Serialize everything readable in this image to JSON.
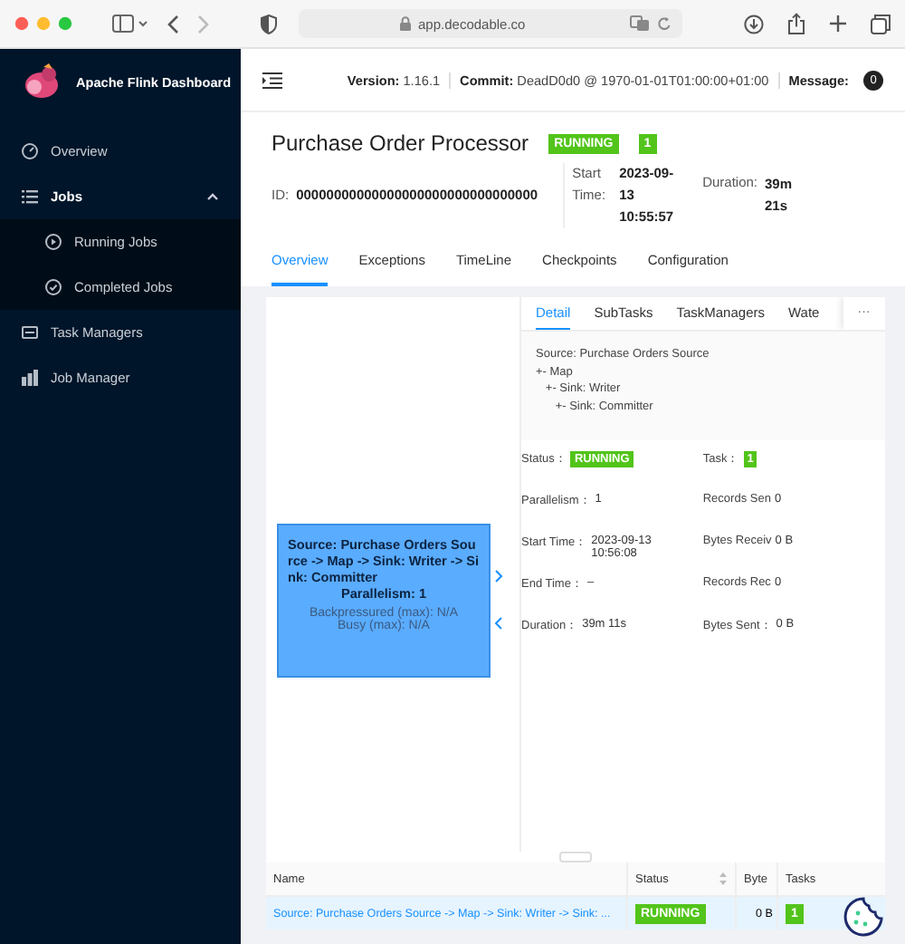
{
  "browser": {
    "url": "app.decodable.co"
  },
  "sidebar": {
    "title": "Apache Flink Dashboard",
    "items": [
      {
        "label": "Overview"
      },
      {
        "label": "Jobs",
        "expanded": true,
        "children": [
          {
            "label": "Running Jobs"
          },
          {
            "label": "Completed Jobs"
          }
        ]
      },
      {
        "label": "Task Managers"
      },
      {
        "label": "Job Manager"
      }
    ]
  },
  "header": {
    "version_label": "Version:",
    "version": "1.16.1",
    "commit_label": "Commit:",
    "commit": "DeadD0d0 @ 1970-01-01T01:00:00+01:00",
    "message_label": "Message:",
    "message_count": "0"
  },
  "job": {
    "title": "Purchase Order Processor",
    "status": "RUNNING",
    "tasks": "1",
    "fields": [
      {
        "label": "ID:",
        "value": "00000000000000000000000000000000"
      },
      {
        "label": "Start Time:",
        "value": "2023-09-13 10:55:57"
      },
      {
        "label": "Duration:",
        "value": "39m 21s"
      }
    ]
  },
  "tabs": [
    {
      "label": "Overview",
      "selected": true
    },
    {
      "label": "Exceptions",
      "selected": false
    },
    {
      "label": "TimeLine",
      "selected": false
    },
    {
      "label": "Checkpoints",
      "selected": false
    },
    {
      "label": "Configuration",
      "selected": false
    }
  ],
  "node": {
    "title": "Source: Purchase Orders Source -> Map -> Sink: Writer -> Sink: Committer",
    "parallelism": "Parallelism: 1",
    "metrics": [
      "Backpressured (max): N/A",
      "Busy (max): N/A"
    ]
  },
  "drawer": {
    "tabs": [
      {
        "label": "Detail",
        "selected": true
      },
      {
        "label": "SubTasks",
        "selected": false
      },
      {
        "label": "TaskManagers",
        "selected": false
      },
      {
        "label": "Wate",
        "selected": false
      }
    ],
    "more": "···",
    "plan": [
      "Source: Purchase Orders Source",
      "+- Map",
      "   +- Sink: Writer",
      "      +- Sink: Committer"
    ],
    "details": [
      {
        "label": "Status：",
        "value": "RUNNING",
        "kind": "tag"
      },
      {
        "label": "Task：",
        "value": "1",
        "kind": "tag"
      },
      {
        "label": "Parallelism：",
        "value": "1",
        "kind": "text"
      },
      {
        "label": "Records Sen",
        "value": "0",
        "kind": "text"
      },
      {
        "label": "Start Time：",
        "value": "2023-09-13 10:56:08",
        "kind": "text"
      },
      {
        "label": "Bytes Receiv",
        "value": "0 B",
        "kind": "text"
      },
      {
        "label": "End Time：",
        "value": "–",
        "kind": "text"
      },
      {
        "label": "Records Rec",
        "value": "0",
        "kind": "text"
      },
      {
        "label": "Duration：",
        "value": "39m 11s",
        "kind": "text"
      },
      {
        "label": "Bytes Sent：",
        "value": "0 B",
        "kind": "text"
      }
    ]
  },
  "table": {
    "columns": [
      {
        "label": "Name",
        "sortable": false
      },
      {
        "label": "Status",
        "sortable": true
      },
      {
        "label": "Byte",
        "sortable": false
      },
      {
        "label": "Tasks",
        "sortable": false
      }
    ],
    "rows": [
      {
        "name": "Source: Purchase Orders Source -> Map -> Sink: Writer -> Sink: ...",
        "status": "RUNNING",
        "bytes": "0 B",
        "tasks": "1",
        "selected": true
      }
    ]
  }
}
